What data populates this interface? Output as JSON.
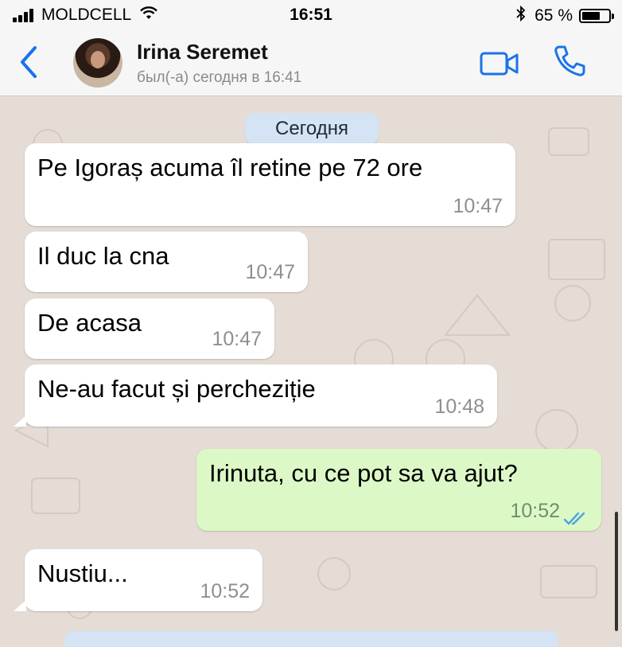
{
  "status_bar": {
    "carrier": "MOLDCELL",
    "time": "16:51",
    "battery_text": "65 %",
    "battery_level": 0.65
  },
  "header": {
    "contact_name": "Irina Seremet",
    "last_seen": "был(-а) сегодня в 16:41",
    "icons": [
      "back-chevron-icon",
      "avatar",
      "video-call-icon",
      "phone-call-icon"
    ]
  },
  "chat": {
    "date_label": "Сегодня",
    "messages": [
      {
        "direction": "in",
        "text": "Pe Igoraș acuma îl retine pe 72 ore",
        "time": "10:47"
      },
      {
        "direction": "in",
        "text": "Il duc la cna",
        "time": "10:47"
      },
      {
        "direction": "in",
        "text": "De acasa",
        "time": "10:47"
      },
      {
        "direction": "in",
        "text": "Ne-au facut și percheziție",
        "time": "10:48"
      },
      {
        "direction": "out",
        "text": "Irinuta, cu ce pot sa va ajut?",
        "time": "10:52",
        "status": "read"
      },
      {
        "direction": "in",
        "text": "Nustiu...",
        "time": "10:52"
      }
    ]
  },
  "colors": {
    "accent": "#1a73e8",
    "incoming_bubble": "#ffffff",
    "outgoing_bubble": "#dcf8c6",
    "chat_background": "#e5ddd5",
    "read_ticks": "#4fa3e0"
  }
}
